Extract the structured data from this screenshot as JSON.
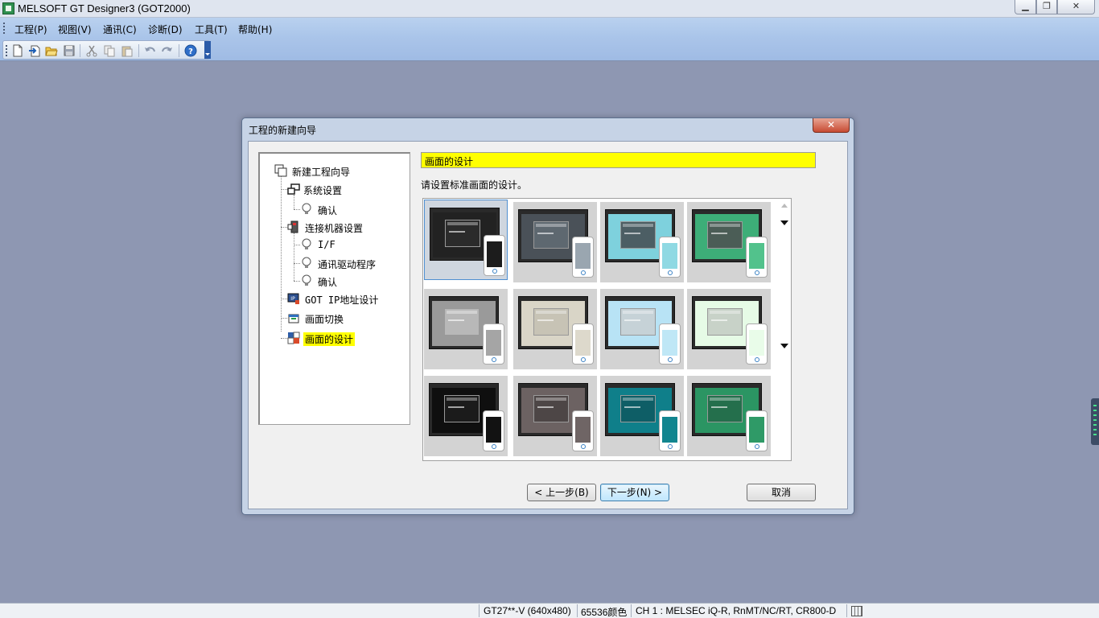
{
  "window": {
    "title": "MELSOFT GT Designer3 (GOT2000)",
    "min_glyph": "▁",
    "max_glyph": "❐",
    "close_glyph": "✕"
  },
  "menu": {
    "items": [
      {
        "label": "工程(P)"
      },
      {
        "label": "视图(V)"
      },
      {
        "label": "通讯(C)"
      },
      {
        "label": "诊断(D)"
      },
      {
        "label": "工具(T)"
      },
      {
        "label": "帮助(H)"
      }
    ]
  },
  "toolbar": {
    "icons": [
      "new-file-icon",
      "open-project-icon",
      "open-folder-icon",
      "save-icon",
      "cut-icon",
      "copy-icon",
      "paste-icon",
      "undo-icon",
      "redo-icon",
      "help-icon"
    ]
  },
  "dialog": {
    "title": "工程的新建向导",
    "close_glyph": "✕",
    "tree": [
      {
        "label": "新建工程向导",
        "icon": "wizard-icon"
      },
      {
        "label": "系统设置",
        "icon": "system-icon"
      },
      {
        "label": "确认",
        "icon": "bulb-icon"
      },
      {
        "label": "连接机器设置",
        "icon": "connection-icon"
      },
      {
        "label": "I/F",
        "icon": "bulb-icon"
      },
      {
        "label": "通讯驱动程序",
        "icon": "bulb-icon"
      },
      {
        "label": "确认",
        "icon": "bulb-icon"
      },
      {
        "label": "GOT IP地址设计",
        "icon": "ip-address-icon"
      },
      {
        "label": "画面切换",
        "icon": "screen-switch-icon"
      },
      {
        "label": "画面的设计",
        "icon": "screen-design-icon"
      }
    ],
    "section_header": "画面的设计",
    "description": "请设置标准画面的设计。",
    "themes": [
      {
        "color": "#1c1c1c",
        "screen": "#222222",
        "window": "#2b2b2b"
      },
      {
        "color": "#9aa6b0",
        "screen": "#4a5158",
        "window": "#5e6870"
      },
      {
        "color": "#8fd9e3",
        "screen": "#7ed1dd",
        "window": "#4c5e64"
      },
      {
        "color": "#52c28c",
        "screen": "#3dae78",
        "window": "#4b5d56"
      },
      {
        "color": "#a5a5a5",
        "screen": "#9a9a9a",
        "window": "#b8b8b8"
      },
      {
        "color": "#ddd9cc",
        "screen": "#d9d5c7",
        "window": "#c7c3b5"
      },
      {
        "color": "#bfe7f6",
        "screen": "#b8e3f5",
        "window": "#c6d2d7"
      },
      {
        "color": "#e9fce9",
        "screen": "#e6fbe6",
        "window": "#c8d2c8"
      },
      {
        "color": "#121212",
        "screen": "#0f0f0f",
        "window": "#1b1b1b"
      },
      {
        "color": "#6f6565",
        "screen": "#6c6262",
        "window": "#4d4646"
      },
      {
        "color": "#11858f",
        "screen": "#0f7f8a",
        "window": "#0e5e66"
      },
      {
        "color": "#2f9a67",
        "screen": "#2b9563",
        "window": "#246f4c"
      }
    ],
    "buttons": {
      "back": "< 上一步(B)",
      "next": "下一步(N) >",
      "cancel": "取消"
    }
  },
  "statusbar": {
    "model": "GT27**-V (640x480)",
    "colors": "65536颜色",
    "channel": "CH 1 : MELSEC iQ-R, RnMT/NC/RT, CR800-D"
  }
}
